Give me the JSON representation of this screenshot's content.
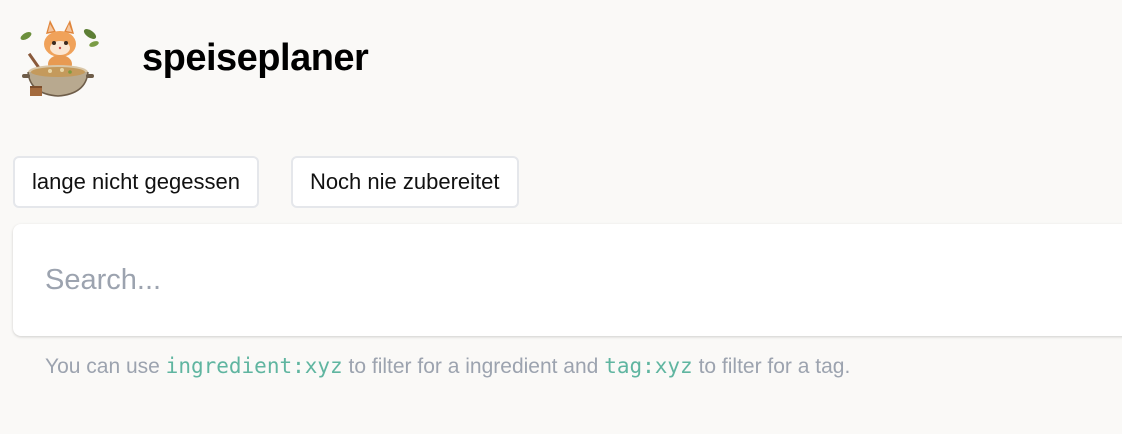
{
  "header": {
    "title": "speiseplaner",
    "logo_icon": "cooking-cat-logo"
  },
  "filters": [
    {
      "label": "lange nicht gegessen"
    },
    {
      "label": "Noch nie zubereitet"
    }
  ],
  "search": {
    "value": "",
    "placeholder": "Search..."
  },
  "hint": {
    "text_before": "You can use",
    "code_ingredient": "ingredient:xyz",
    "text_middle": "to filter for a ingredient and",
    "code_tag": "tag:xyz",
    "text_after": "to filter for a tag."
  },
  "colors": {
    "background": "#faf9f7",
    "code_accent": "#5fb5a0",
    "muted_text": "#9ca3af"
  }
}
